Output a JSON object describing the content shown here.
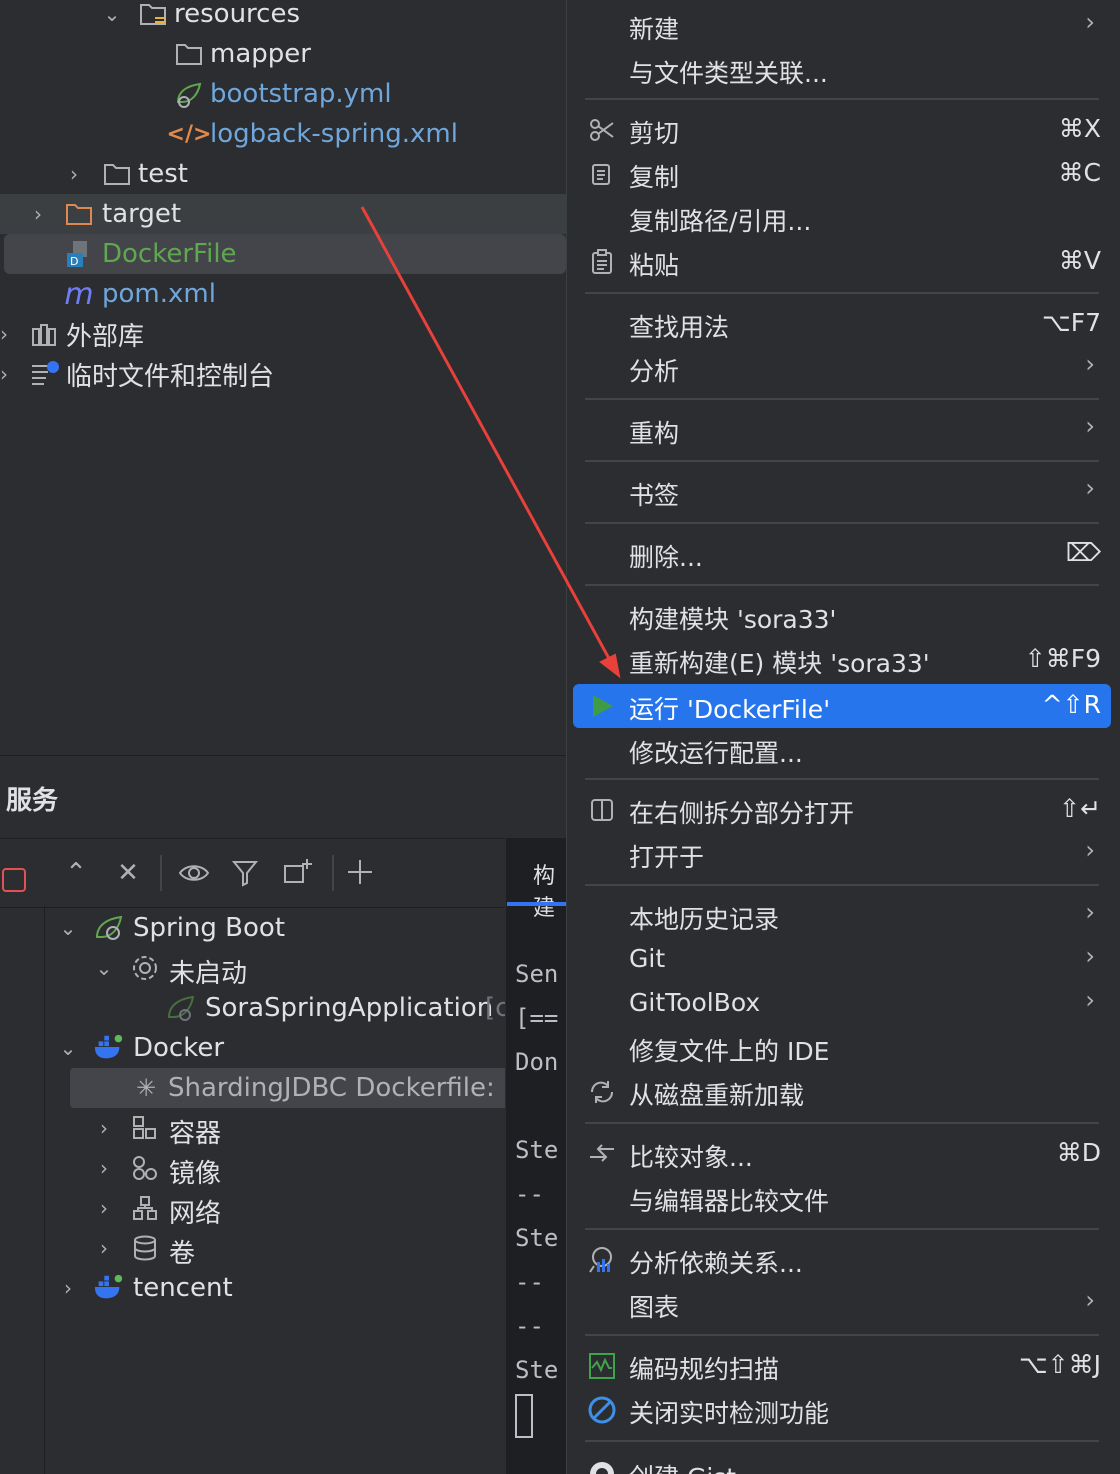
{
  "project_tree": {
    "items": [
      {
        "label": "resources",
        "icon": "folder-resources-icon"
      },
      {
        "label": "mapper",
        "icon": "folder-icon"
      },
      {
        "label": "bootstrap.yml",
        "icon": "spring-config-icon"
      },
      {
        "label": "logback-spring.xml",
        "icon": "xml-icon"
      },
      {
        "label": "test",
        "icon": "folder-icon"
      },
      {
        "label": "target",
        "icon": "folder-excluded-icon"
      },
      {
        "label": "DockerFile",
        "icon": "dockerfile-icon"
      },
      {
        "label": "pom.xml",
        "icon": "maven-icon"
      },
      {
        "label": "外部库",
        "icon": "library-icon"
      },
      {
        "label": "临时文件和控制台",
        "icon": "scratches-icon"
      }
    ]
  },
  "services": {
    "title": "服务",
    "tree": [
      {
        "label": "Spring Boot",
        "icon": "spring-boot-icon"
      },
      {
        "label": "未启动",
        "icon": "gear-icon"
      },
      {
        "label": "SoraSpringApplication",
        "suffix": "[c",
        "icon": "spring-app-icon"
      },
      {
        "label": "Docker",
        "icon": "docker-icon"
      },
      {
        "label": "ShardingJDBC Dockerfile: D",
        "icon": "spinner-icon"
      },
      {
        "label": "容器",
        "icon": "containers-icon"
      },
      {
        "label": "镜像",
        "icon": "images-icon"
      },
      {
        "label": "网络",
        "icon": "network-icon"
      },
      {
        "label": "卷",
        "icon": "volumes-icon"
      },
      {
        "label": "tencent",
        "icon": "docker-icon"
      }
    ],
    "console": {
      "tab": "构建",
      "lines": [
        "Sen",
        "[==",
        "Don",
        "Ste",
        " --",
        "Ste",
        " --",
        " --",
        "Ste"
      ]
    }
  },
  "context_menu": {
    "items": [
      {
        "label": "新建",
        "submenu": true
      },
      {
        "label": "与文件类型关联..."
      },
      {
        "label": "剪切",
        "shortcut": "⌘X",
        "icon": "scissors-icon"
      },
      {
        "label": "复制",
        "shortcut": "⌘C",
        "icon": "copy-icon"
      },
      {
        "label": "复制路径/引用..."
      },
      {
        "label": "粘贴",
        "shortcut": "⌘V",
        "icon": "paste-icon"
      },
      {
        "label": "查找用法",
        "shortcut": "⌥F7"
      },
      {
        "label": "分析",
        "submenu": true
      },
      {
        "label": "重构",
        "submenu": true
      },
      {
        "label": "书签",
        "submenu": true
      },
      {
        "label": "删除...",
        "shortcut": "⌦"
      },
      {
        "label": "构建模块 'sora33'"
      },
      {
        "label": "重新构建(E) 模块 'sora33'",
        "shortcut": "⇧⌘F9"
      },
      {
        "label": "运行 'DockerFile'",
        "shortcut": "^⇧R",
        "icon": "run-icon",
        "active": true
      },
      {
        "label": "修改运行配置..."
      },
      {
        "label": "在右侧拆分部分打开",
        "shortcut": "⇧↵",
        "icon": "split-icon"
      },
      {
        "label": "打开于",
        "submenu": true
      },
      {
        "label": "本地历史记录",
        "submenu": true
      },
      {
        "label": "Git",
        "submenu": true
      },
      {
        "label": "GitToolBox",
        "submenu": true
      },
      {
        "label": "修复文件上的 IDE"
      },
      {
        "label": "从磁盘重新加载",
        "icon": "reload-icon"
      },
      {
        "label": "比较对象...",
        "shortcut": "⌘D",
        "icon": "compare-icon"
      },
      {
        "label": "与编辑器比较文件"
      },
      {
        "label": "分析依赖关系...",
        "icon": "dependencies-icon"
      },
      {
        "label": "图表",
        "submenu": true
      },
      {
        "label": "编码规约扫描",
        "shortcut": "⌥⇧⌘J",
        "icon": "scan-icon"
      },
      {
        "label": "关闭实时检测功能",
        "icon": "disable-icon"
      },
      {
        "label": "创建 Gist...",
        "icon": "github-icon"
      }
    ],
    "submenu_arrow": "›"
  },
  "colors": {
    "accent": "#2675ed",
    "bg": "#2b2d30",
    "arrow": "#e8403b"
  }
}
